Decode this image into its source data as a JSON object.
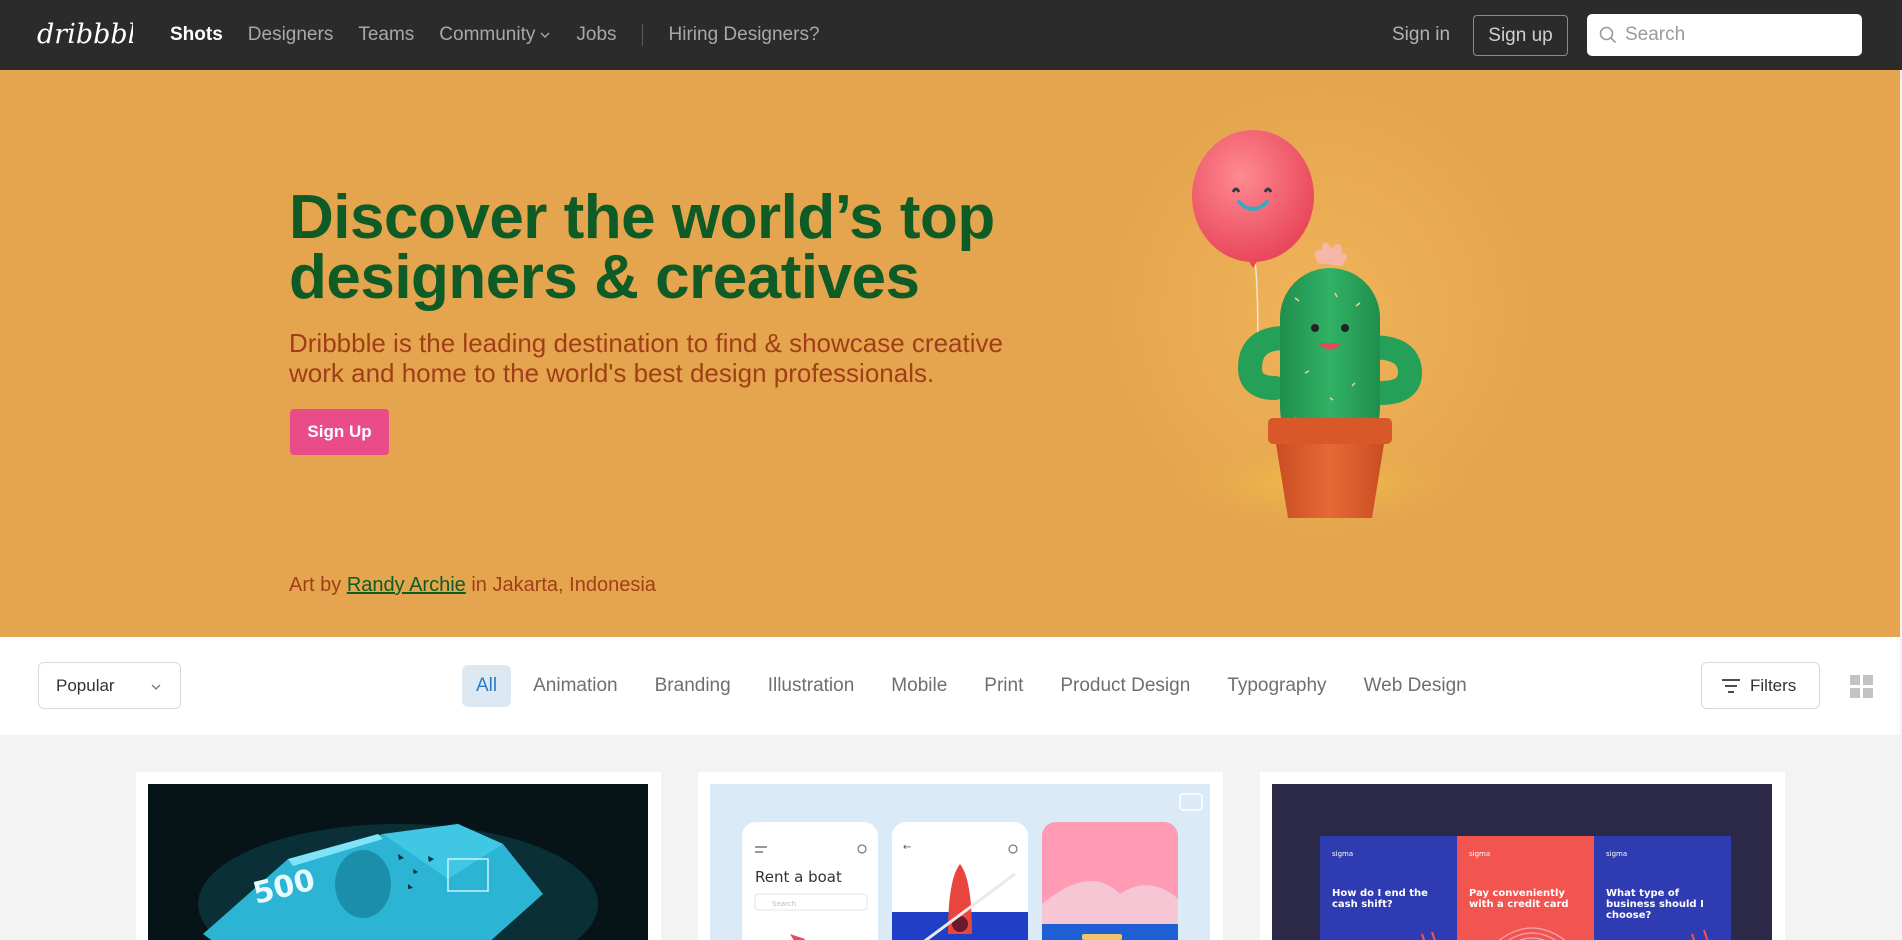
{
  "nav": {
    "links": [
      {
        "label": "Shots",
        "active": true
      },
      {
        "label": "Designers"
      },
      {
        "label": "Teams"
      },
      {
        "label": "Community",
        "has_dropdown": true
      },
      {
        "label": "Jobs"
      }
    ],
    "hiring": "Hiring Designers?",
    "sign_in": "Sign in",
    "sign_up": "Sign up",
    "search_placeholder": "Search"
  },
  "hero": {
    "title": "Discover the world’s top designers & creatives",
    "lead": "Dribbble is the leading destination to find & showcase creative work and home to the world's best design professionals.",
    "cta": "Sign Up",
    "credit_prefix": "Art by",
    "credit_name": "Randy Archie",
    "credit_suffix": "in Jakarta, Indonesia"
  },
  "filterbar": {
    "sort_value": "Popular",
    "categories": [
      "All",
      "Animation",
      "Branding",
      "Illustration",
      "Mobile",
      "Print",
      "Product Design",
      "Typography",
      "Web Design"
    ],
    "active_category": "All",
    "filters_label": "Filters"
  },
  "shots": [
    {
      "banknote_text": "500"
    },
    {
      "title": "Rent a boat",
      "search_text": "Search"
    },
    {
      "brand": "sigma",
      "cards": [
        "How do I end the cash shift?",
        "Pay conveniently with a credit card",
        "What type of business should I choose?"
      ]
    }
  ],
  "colors": {
    "nav_bg": "#2b2b2b",
    "hero_bg": "#e5a54e",
    "headline": "#0e5b25",
    "lead": "#a13e17",
    "cta": "#ea4c89",
    "active_tab_bg": "#dce9f3",
    "active_tab_text": "#2c7bbf"
  }
}
